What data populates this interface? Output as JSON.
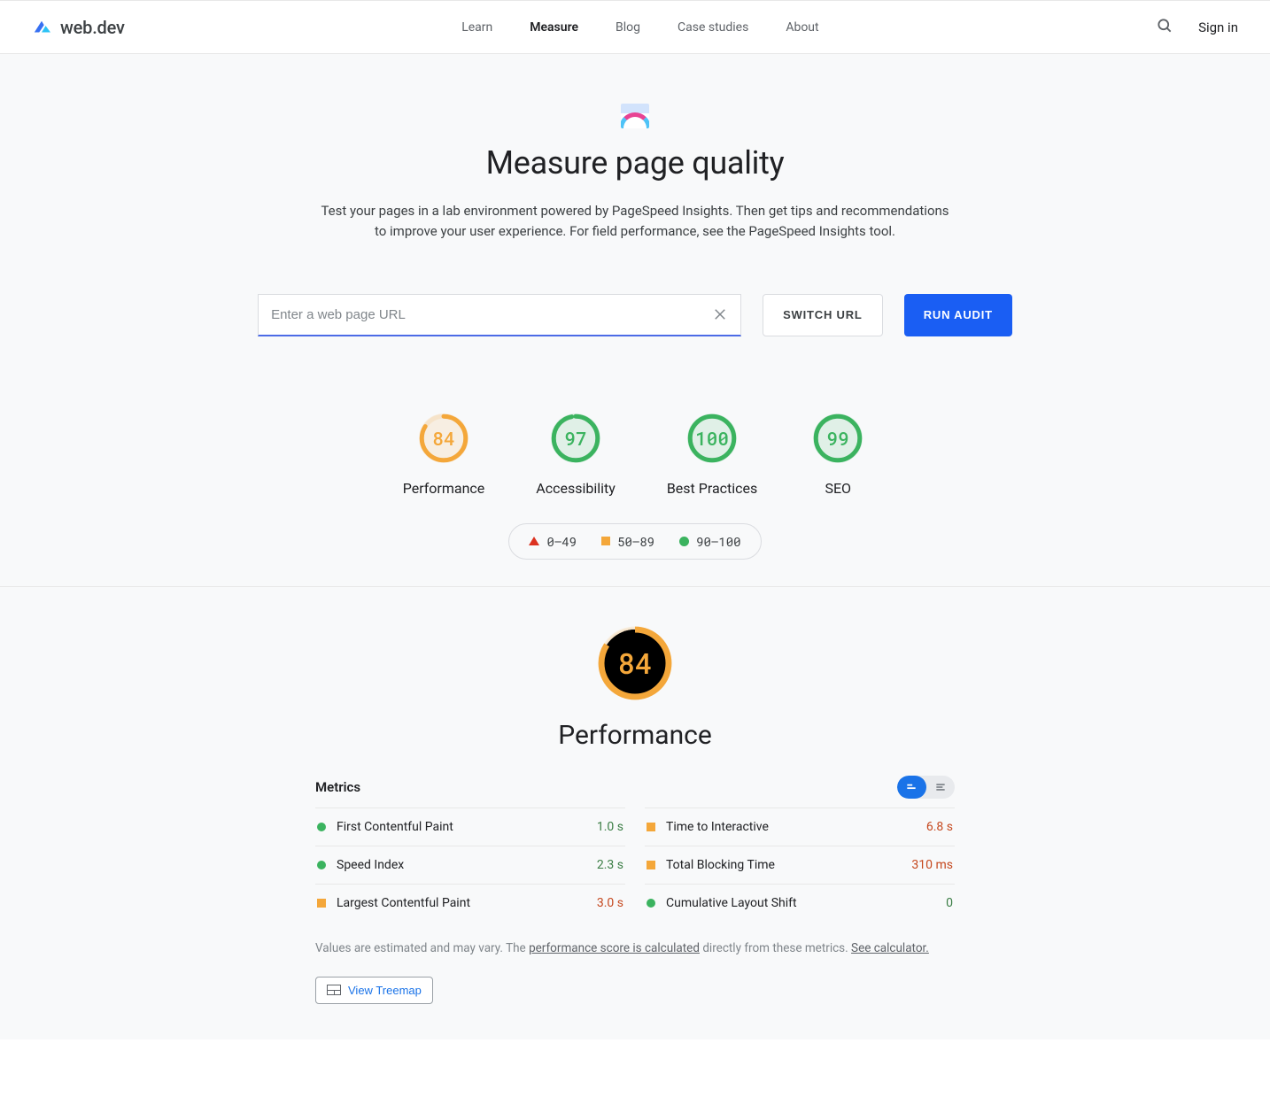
{
  "header": {
    "brand": "web.dev",
    "nav": [
      "Learn",
      "Measure",
      "Blog",
      "Case studies",
      "About"
    ],
    "active_nav": "Measure",
    "signin": "Sign in"
  },
  "hero": {
    "title": "Measure page quality",
    "desc": "Test your pages in a lab environment powered by PageSpeed Insights. Then get tips and recommendations to improve your user experience. For field performance, see the PageSpeed Insights tool."
  },
  "url_bar": {
    "placeholder": "Enter a web page URL",
    "value": "",
    "switch_label": "SWITCH URL",
    "run_label": "RUN AUDIT"
  },
  "gauges": [
    {
      "label": "Performance",
      "score": 84,
      "color": "#f4a73a"
    },
    {
      "label": "Accessibility",
      "score": 97,
      "color": "#3bb35f"
    },
    {
      "label": "Best Practices",
      "score": 100,
      "color": "#3bb35f"
    },
    {
      "label": "SEO",
      "score": 99,
      "color": "#3bb35f"
    }
  ],
  "legend": [
    {
      "shape": "tri",
      "range": "0–49"
    },
    {
      "shape": "sq",
      "range": "50–89"
    },
    {
      "shape": "ci",
      "range": "90–100"
    }
  ],
  "detail": {
    "big_score": 84,
    "big_color": "#f4a73a",
    "title": "Performance",
    "metrics_heading": "Metrics",
    "metrics": [
      {
        "name": "First Contentful Paint",
        "value": "1.0 s",
        "status": "good",
        "color": "#3bb35f",
        "val_color": "#3a7d44"
      },
      {
        "name": "Time to Interactive",
        "value": "6.8 s",
        "status": "avg",
        "color": "#f4a73a",
        "val_color": "#c5481e"
      },
      {
        "name": "Speed Index",
        "value": "2.3 s",
        "status": "good",
        "color": "#3bb35f",
        "val_color": "#3a7d44"
      },
      {
        "name": "Total Blocking Time",
        "value": "310 ms",
        "status": "avg",
        "color": "#f4a73a",
        "val_color": "#c5481e"
      },
      {
        "name": "Largest Contentful Paint",
        "value": "3.0 s",
        "status": "avg",
        "color": "#f4a73a",
        "val_color": "#c5481e"
      },
      {
        "name": "Cumulative Layout Shift",
        "value": "0",
        "status": "good",
        "color": "#3bb35f",
        "val_color": "#3a7d44"
      }
    ],
    "footnote_pre": "Values are estimated and may vary. The ",
    "footnote_link1": "performance score is calculated",
    "footnote_mid": " directly from these metrics. ",
    "footnote_link2": "See calculator.",
    "treemap_label": "View Treemap"
  }
}
